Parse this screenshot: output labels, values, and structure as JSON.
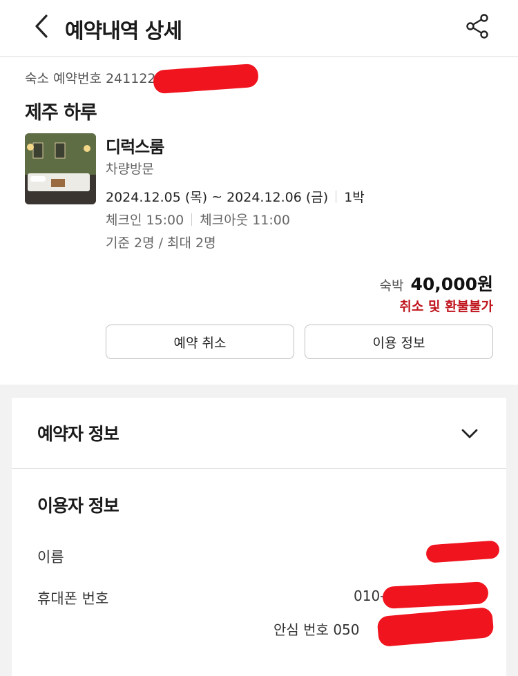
{
  "header": {
    "title": "예약내역 상세",
    "back_icon": "chevron-left-icon",
    "share_icon": "share-icon"
  },
  "booking": {
    "reservation_number_label": "숙소 예약번호",
    "reservation_number_visible": "2411220",
    "stay_name": "제주 하루",
    "room_name": "디럭스룸",
    "visit_type": "차량방문",
    "check_in_date": "2024.12.05 (목)",
    "date_separator": "~",
    "check_out_date": "2024.12.06 (금)",
    "nights": "1박",
    "check_in_time": "체크인 15:00",
    "check_out_time": "체크아웃 11:00",
    "capacity": "기준 2명 / 최대 2명",
    "price_label": "숙박",
    "price": "40,000원",
    "refund_policy": "취소 및 환불불가",
    "cancel_button": "예약 취소",
    "info_button": "이용 정보"
  },
  "reserver_section": {
    "title": "예약자 정보",
    "toggle_icon": "chevron-down-icon"
  },
  "user_section": {
    "title": "이용자 정보",
    "name_label": "이름",
    "phone_label": "휴대폰 번호",
    "phone_value_visible": "010-",
    "safe_number_label": "안심 번호",
    "safe_number_visible": "050"
  },
  "colors": {
    "accent_red": "#c0161f",
    "redaction": "#f0141e",
    "page_bg": "#f2f2f2"
  }
}
